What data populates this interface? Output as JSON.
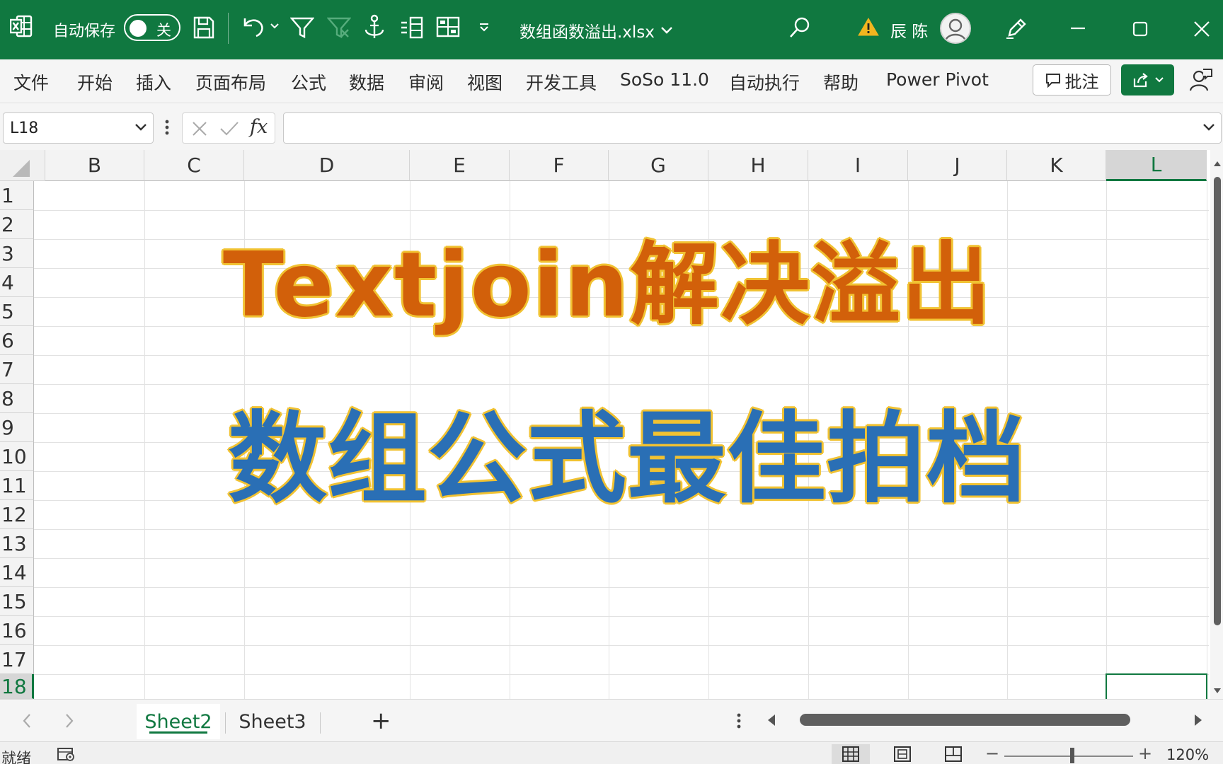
{
  "titlebar": {
    "autosave_label": "自动保存",
    "autosave_state": "关",
    "filename": "数组函数溢出.xlsx",
    "username": "辰 陈",
    "brand_color": "#107840"
  },
  "ribbon": {
    "tabs": [
      "文件",
      "开始",
      "插入",
      "页面布局",
      "公式",
      "数据",
      "审阅",
      "视图",
      "开发工具",
      "SoSo 11.0",
      "自动执行",
      "帮助",
      "Power Pivot"
    ],
    "comment_label": "批注"
  },
  "formula_bar": {
    "name_box": "L18",
    "fx_label": "fx",
    "formula": ""
  },
  "grid": {
    "columns": [
      "B",
      "C",
      "D",
      "E",
      "F",
      "G",
      "H",
      "I",
      "J",
      "K",
      "L"
    ],
    "active_column": "L",
    "rows": [
      "1",
      "2",
      "3",
      "4",
      "5",
      "6",
      "7",
      "8",
      "9",
      "10",
      "11",
      "12",
      "13",
      "14",
      "15",
      "16",
      "17",
      "18"
    ],
    "active_row": "18",
    "banner_line1": "Textjoin解决溢出",
    "banner_line2": "数组公式最佳拍档",
    "banner_line1_color": "#d2600a",
    "banner_line2_color": "#2a6fb5",
    "banner_outline_color": "#f1c232"
  },
  "sheets": {
    "tabs": [
      "Sheet2",
      "Sheet3"
    ],
    "active": "Sheet2",
    "add_label": "+"
  },
  "statusbar": {
    "status": "就绪",
    "zoom_level": "120%",
    "zoom_minus": "−",
    "zoom_plus": "+"
  }
}
